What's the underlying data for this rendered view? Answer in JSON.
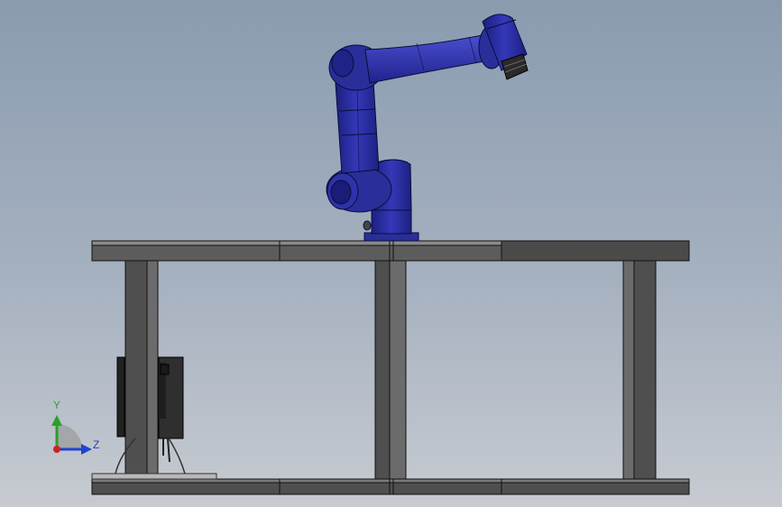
{
  "viewport": {
    "bg_top": "#8a9bb0",
    "bg_bottom": "#c7cbd1"
  },
  "robot": {
    "color": "#2a2f9c",
    "edge": "#0b0d3a",
    "tool_color": "#2a2a2a"
  },
  "table": {
    "frame_color": "#555555",
    "top_color": "#6a6a6a",
    "edge": "#111111"
  },
  "controller": {
    "color": "#2b2b2b"
  },
  "triad": {
    "y_label": "Y",
    "z_label": "Z",
    "y_color": "#2aa02a",
    "z_color": "#2244cc",
    "origin_color": "#cc2222"
  }
}
